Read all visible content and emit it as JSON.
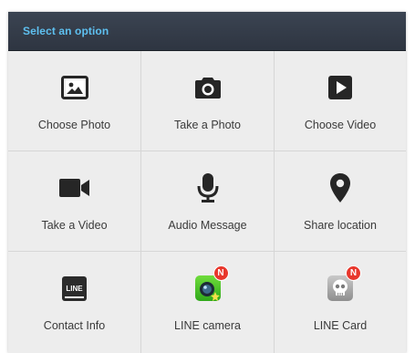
{
  "dialog": {
    "title": "Select an option",
    "options": [
      {
        "label": "Choose Photo",
        "icon": "photo-icon"
      },
      {
        "label": "Take a Photo",
        "icon": "camera-icon"
      },
      {
        "label": "Choose Video",
        "icon": "video-play-icon"
      },
      {
        "label": "Take a Video",
        "icon": "video-camera-icon"
      },
      {
        "label": "Audio Message",
        "icon": "microphone-icon"
      },
      {
        "label": "Share location",
        "icon": "location-pin-icon"
      },
      {
        "label": "Contact Info",
        "icon": "line-contact-icon"
      },
      {
        "label": "LINE camera",
        "icon": "line-camera-app-icon",
        "badge": "N"
      },
      {
        "label": "LINE Card",
        "icon": "line-card-app-icon",
        "badge": "N"
      }
    ]
  },
  "colors": {
    "header_bg": "#333a46",
    "title_text": "#5ec0f0",
    "icon_dark": "#262626",
    "badge": "#e8372c"
  }
}
